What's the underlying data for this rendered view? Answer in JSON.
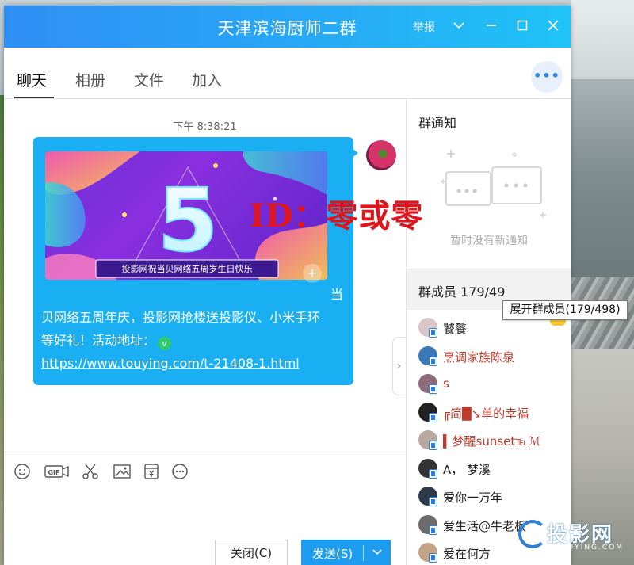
{
  "window": {
    "title": "天津滨海厨师二群",
    "report_label": "举报"
  },
  "tabs": [
    {
      "label": "聊天",
      "active": true
    },
    {
      "label": "相册"
    },
    {
      "label": "文件"
    },
    {
      "label": "加入"
    }
  ],
  "more_label": "•••",
  "chat": {
    "time": "下午 8:38:21",
    "banner_text": "投影网祝当贝网络五周岁生日快乐",
    "banner_big": "5",
    "message_first": "当",
    "message_line2": "贝网络五周年庆，投影网抢楼送投影仪、小米手环",
    "message_line3": "等好礼！活动地址：",
    "link": "https://www.touying.com/t-21408-1.html"
  },
  "overlay_id_text": "ID：零或零",
  "notice": {
    "title": "群通知",
    "empty": "暂时没有新通知"
  },
  "members": {
    "title": "群成员",
    "count": "179/49",
    "tooltip": "展开群成员(179/498)",
    "list": [
      {
        "name": "饕餮",
        "color": "#222222",
        "avatar": "#d8c6c6"
      },
      {
        "name": "烹调家族陈泉",
        "color": "#c0392b",
        "avatar": "#3a78b8"
      },
      {
        "name": "s",
        "color": "#c0392b",
        "avatar": "#8c6a7a"
      },
      {
        "name": "╔简█↘单的幸福",
        "color": "#c0392b",
        "avatar": "#222222"
      },
      {
        "name": "▍梦醒sunset℡ℳ",
        "color": "#c0392b",
        "avatar": "#b8a9a0"
      },
      {
        "name": "A，        梦溪",
        "color": "#222222",
        "avatar": "#333333"
      },
      {
        "name": "爱你一万年",
        "color": "#222222",
        "avatar": "#2f3a48"
      },
      {
        "name": "爱生活@牛老板",
        "color": "#222222",
        "avatar": "#6b6b6b"
      },
      {
        "name": "爱在何方",
        "color": "#222222",
        "avatar": "#c4a486"
      }
    ]
  },
  "toolbar": {
    "icons": [
      "emoji-icon",
      "gif-icon",
      "scissors-icon",
      "image-icon",
      "money-icon",
      "more-icon"
    ],
    "gif_label": "GIF"
  },
  "buttons": {
    "close": "关闭(C)",
    "send": "发送(S)"
  },
  "logo_watermark": {
    "text": "投影网",
    "sub": "TOUYING.COM"
  }
}
